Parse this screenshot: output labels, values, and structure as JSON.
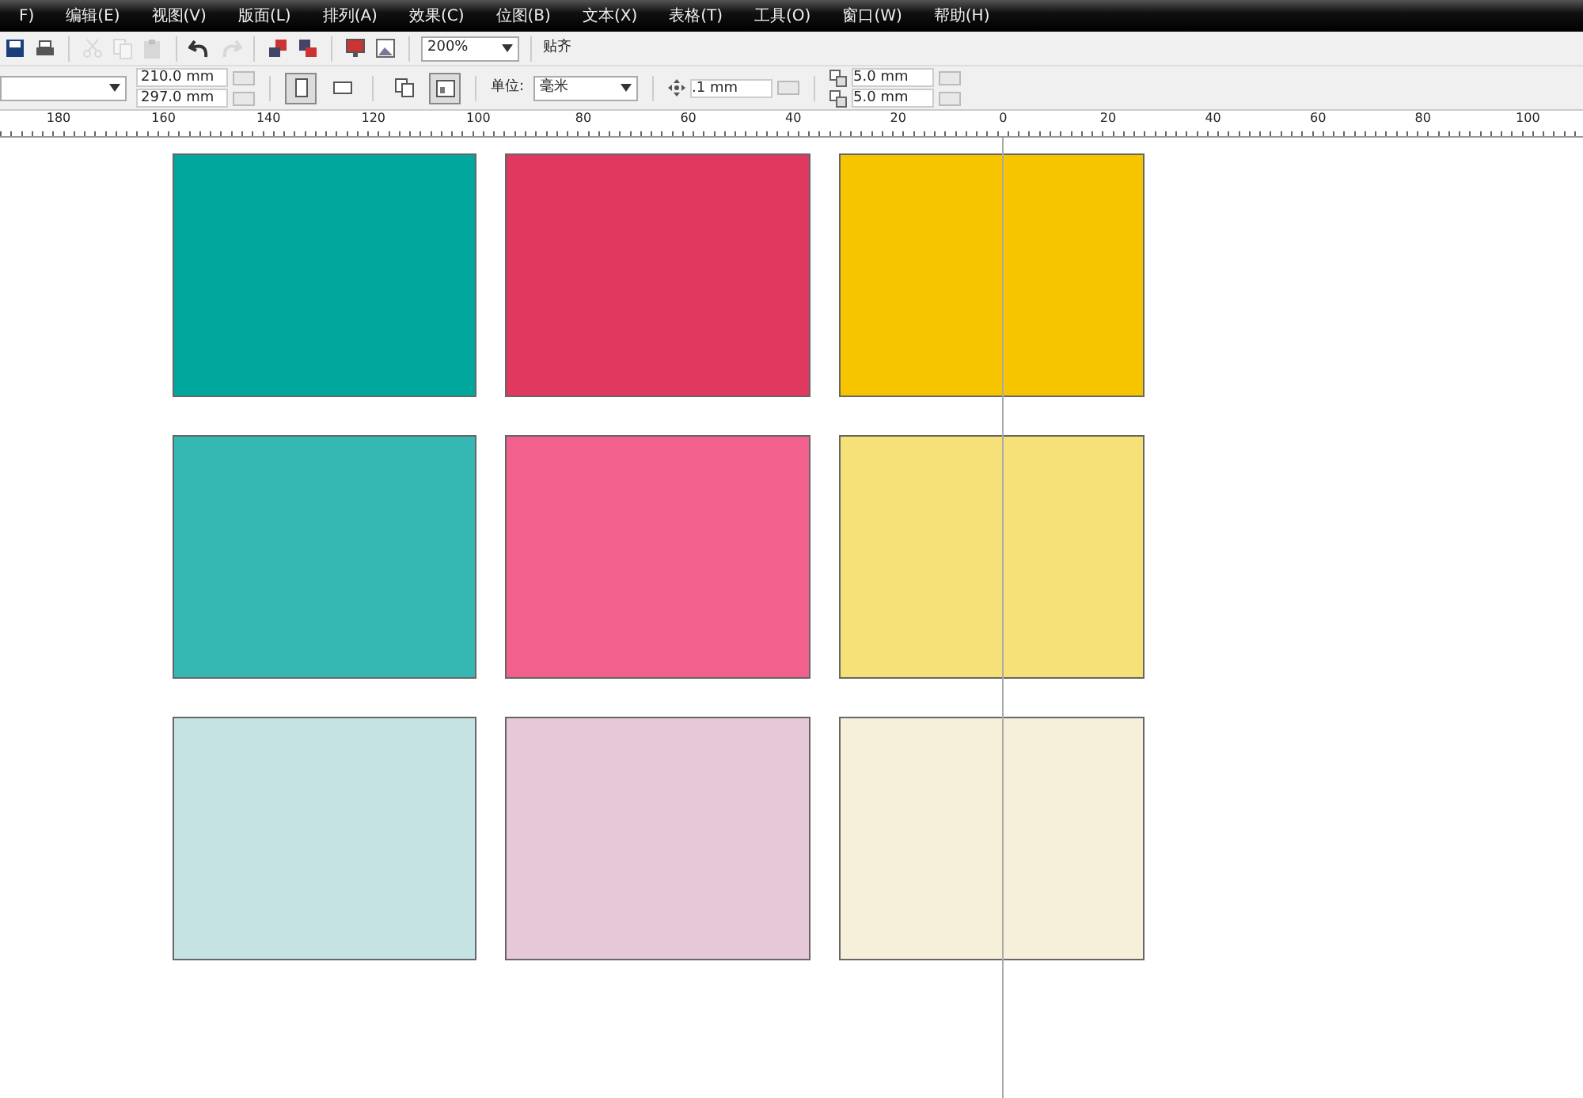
{
  "menu": [
    {
      "label": "F)"
    },
    {
      "label": "编辑(E)"
    },
    {
      "label": "视图(V)"
    },
    {
      "label": "版面(L)"
    },
    {
      "label": "排列(A)"
    },
    {
      "label": "效果(C)"
    },
    {
      "label": "位图(B)"
    },
    {
      "label": "文本(X)"
    },
    {
      "label": "表格(T)"
    },
    {
      "label": "工具(O)"
    },
    {
      "label": "窗口(W)"
    },
    {
      "label": "帮助(H)"
    }
  ],
  "standard_toolbar": {
    "tools": [
      {
        "kind": "save",
        "disabled": false
      },
      {
        "kind": "print",
        "disabled": false
      },
      {
        "kind": "cut",
        "disabled": true
      },
      {
        "kind": "copy",
        "disabled": true
      },
      {
        "kind": "paste",
        "disabled": true
      },
      {
        "kind": "undo",
        "disabled": false
      },
      {
        "kind": "redo",
        "disabled": true
      },
      {
        "kind": "import",
        "disabled": false
      },
      {
        "kind": "export",
        "disabled": false
      },
      {
        "kind": "publish",
        "disabled": false
      },
      {
        "kind": "launcher",
        "disabled": false
      }
    ],
    "zoom": "200%",
    "snap": "贴齐"
  },
  "property_bar": {
    "page_width": "210.0 mm",
    "page_height": "297.0 mm",
    "orientation": [
      {
        "kind": "portrait",
        "selected": true
      },
      {
        "kind": "landscape",
        "selected": false
      }
    ],
    "page_layout": [
      {
        "kind": "all-pages",
        "selected": false
      },
      {
        "kind": "current-page",
        "selected": true
      }
    ],
    "units_label": "单位:",
    "units": "毫米",
    "nudge": ".1 mm",
    "duplicate_x": "5.0 mm",
    "duplicate_y": "5.0 mm"
  },
  "ruler": [
    "180",
    "160",
    "140",
    "120",
    "100",
    "80",
    "60",
    "40",
    "20",
    "0",
    "20",
    "40",
    "60",
    "80",
    "100"
  ],
  "swatches": [
    {
      "color": "#00a79d"
    },
    {
      "color": "#e0385e"
    },
    {
      "color": "#f7c400"
    },
    {
      "color": "#35b8b4"
    },
    {
      "color": "#f2608d"
    },
    {
      "color": "#f6e078"
    },
    {
      "color": "#c6e3e4"
    },
    {
      "color": "#e6c8d6"
    },
    {
      "color": "#f6f0db"
    }
  ]
}
